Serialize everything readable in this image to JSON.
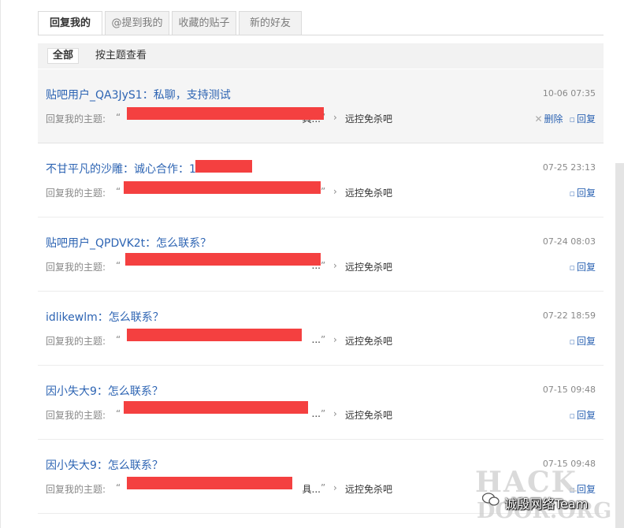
{
  "tabs": [
    "回复我的",
    "@提到我的",
    "收藏的贴子",
    "新的好友"
  ],
  "filters": [
    "全部",
    "按主题查看"
  ],
  "item_label": "回复我的主题:",
  "open_quote": "“",
  "close_quote": "”",
  "actions": {
    "delete": "删除",
    "reply": "回复"
  },
  "colors": {
    "link": "#2d64b3",
    "redaction": "#f44040",
    "highlight_bg": "#f5f5f5"
  },
  "icons": {
    "delete": "x-icon",
    "reply": "comment-icon",
    "forum": "chevron-right-icon"
  },
  "items": [
    {
      "user": "贴吧用户_QA3JyS1",
      "message": "私聊，支持测试",
      "time": "10-06 07:35",
      "quote": "具...",
      "forum": "远控免杀吧"
    },
    {
      "user": "不甘平凡的沙雕",
      "message": "诚心合作：1",
      "time": "07-25 23:13",
      "quote": "",
      "forum": "远控免杀吧"
    },
    {
      "user": "贴吧用户_QPDVK2t",
      "message": "怎么联系？",
      "time": "07-24 08:03",
      "quote": "...",
      "forum": "远控免杀吧"
    },
    {
      "user": "idlikewlm",
      "message": "怎么联系？",
      "time": "07-22 18:59",
      "quote": "...",
      "forum": "远控免杀吧"
    },
    {
      "user": "因小失大9",
      "message": "怎么联系？",
      "time": "07-15 09:48",
      "quote": "...",
      "forum": "远控免杀吧"
    },
    {
      "user": "因小失大9",
      "message": "怎么联系？",
      "time": "07-15 09:48",
      "quote": "具...",
      "forum": "远控免杀吧"
    }
  ],
  "watermark": {
    "line1": "HACK",
    "line2": "DOOR.ORG",
    "brand": "诚殷网络Team"
  }
}
